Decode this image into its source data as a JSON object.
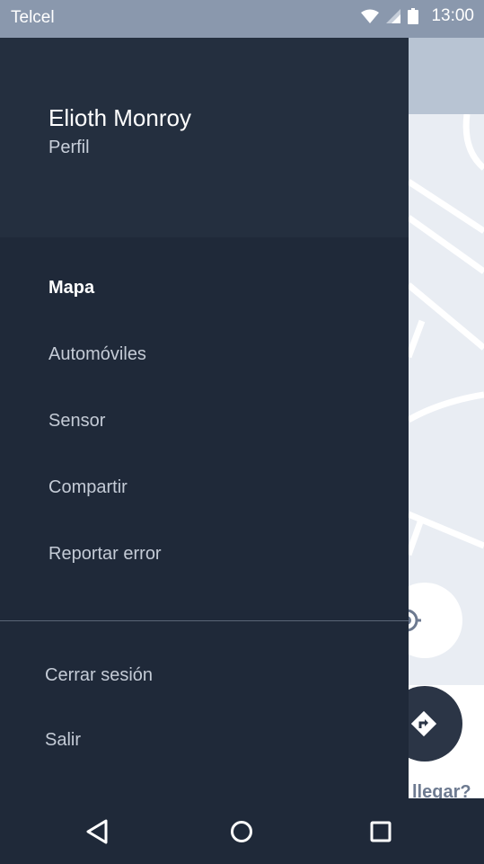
{
  "status_bar": {
    "carrier": "Telcel",
    "time": "13:00",
    "icons": [
      "wifi-icon",
      "signal-icon",
      "battery-icon"
    ]
  },
  "drawer": {
    "user_name": "Elioth Monroy",
    "profile_link": "Perfil",
    "menu_items": [
      {
        "label": "Mapa",
        "active": true
      },
      {
        "label": "Automóviles",
        "active": false
      },
      {
        "label": "Sensor",
        "active": false
      },
      {
        "label": "Compartir",
        "active": false
      },
      {
        "label": "Reportar error",
        "active": false
      }
    ],
    "footer_items": [
      {
        "label": "Cerrar sesión"
      },
      {
        "label": "Salir"
      }
    ]
  },
  "map": {
    "question_partial": "llegar?",
    "buttons": [
      "locate-icon",
      "route-icon"
    ]
  },
  "nav_bar": {
    "icons": [
      "back-icon",
      "home-icon",
      "recents-icon"
    ]
  },
  "colors": {
    "drawer_bg": "#1f2939",
    "drawer_header_bg": "#242f3f",
    "status_bar_bg": "#8a98ad",
    "map_bg": "#e9edf3"
  }
}
